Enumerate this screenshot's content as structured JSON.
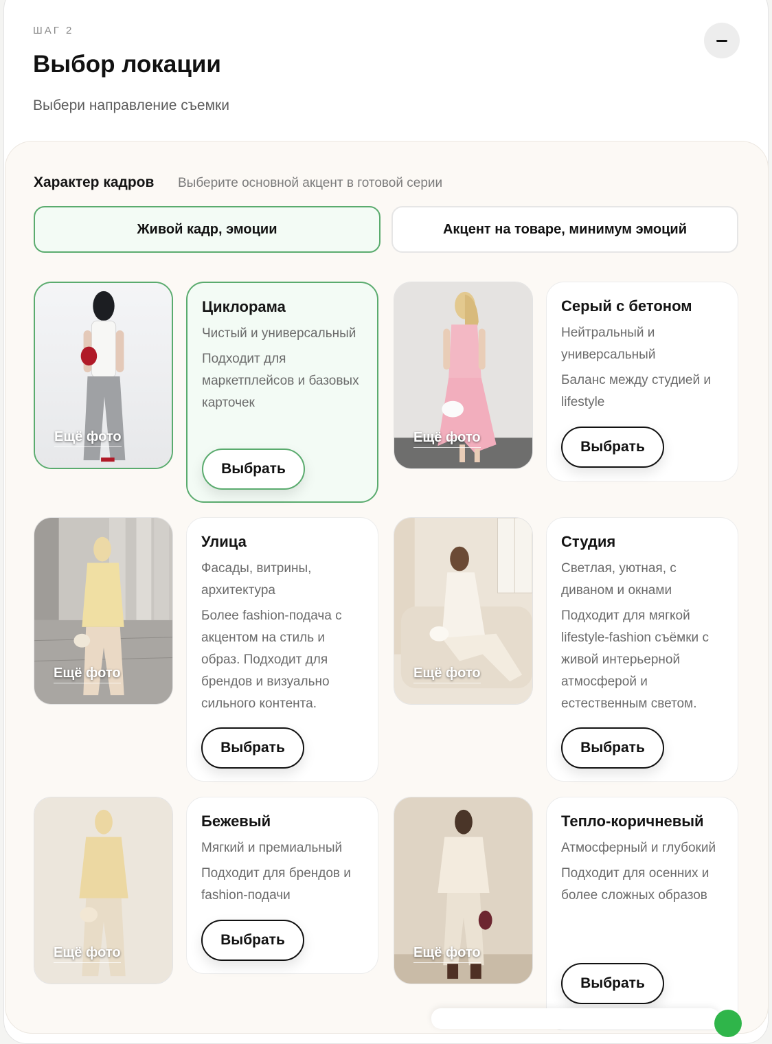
{
  "header": {
    "step": "ШАГ 2",
    "title": "Выбор локации",
    "subtitle": "Выбери направление съемки"
  },
  "character": {
    "label": "Характер кадров",
    "hint": "Выберите основной акцент в готовой серии",
    "options": [
      "Живой кадр, эмоции",
      "Акцент на товаре, минимум эмоций"
    ],
    "selected": "Живой кадр, эмоции"
  },
  "more_photos_label": "Ещё фото",
  "choose_label": "Выбрать",
  "locations": [
    {
      "title": "Циклорама",
      "tagline": "Чистый и универсальный",
      "description": "Подходит для маркетплейсов и базовых карточек",
      "selected": true
    },
    {
      "title": "Серый с бетоном",
      "tagline": "Нейтральный и универсальный",
      "description": "Баланс между студией и lifestyle",
      "selected": false
    },
    {
      "title": "Улица",
      "tagline": "Фасады, витрины, архитектура",
      "description": "Более fashion-подача с акцентом на стиль и образ. Подходит для брендов и визуально сильного контента.",
      "selected": false
    },
    {
      "title": "Студия",
      "tagline": "Светлая, уютная, с диваном и окнами",
      "description": "Подходит для мягкой lifestyle-fashion съёмки с живой интерьерной атмосферой и естественным светом.",
      "selected": false
    },
    {
      "title": "Бежевый",
      "tagline": "Мягкий и премиальный",
      "description": "Подходит для брендов и fashion-подачи",
      "selected": false
    },
    {
      "title": "Тепло-коричневый",
      "tagline": "Атмосферный и глубокий",
      "description": "Подходит для осенних и более сложных образов",
      "selected": false
    }
  ],
  "colors": {
    "accent_green": "#5aab6e",
    "selected_bg": "#f3fbf5",
    "panel_bg": "#fcf9f5"
  }
}
